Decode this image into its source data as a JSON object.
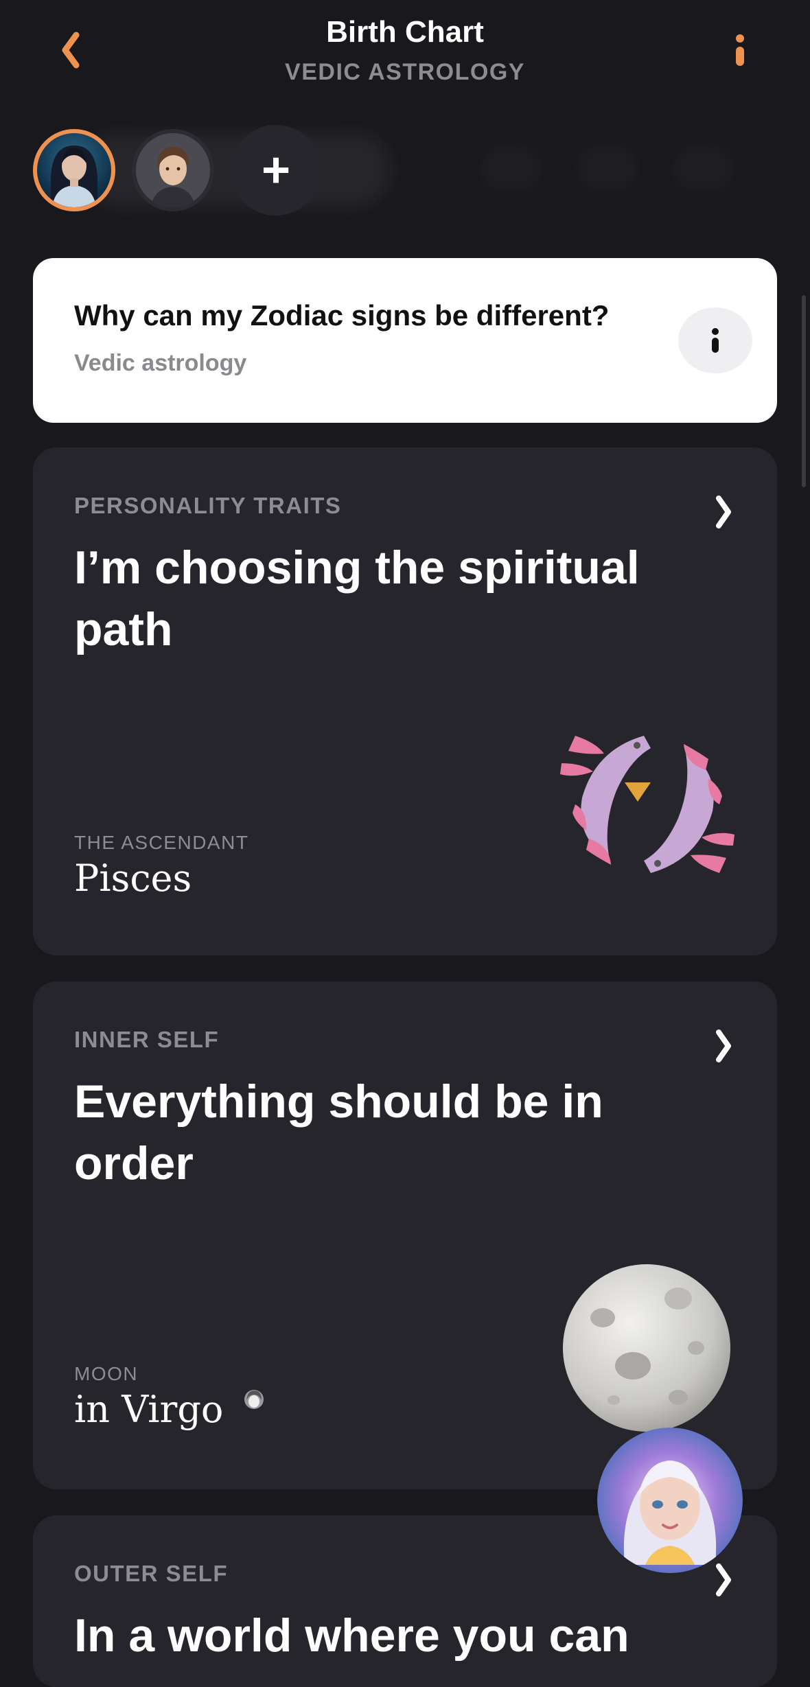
{
  "header": {
    "title": "Birth Chart",
    "subtitle": "VEDIC ASTROLOGY"
  },
  "colors": {
    "accent": "#f0924f",
    "background": "#18181d",
    "card": "#25252b",
    "muted_text": "#8d8c92"
  },
  "profiles": {
    "add_label": "+"
  },
  "info_card": {
    "title": "Why can my Zodiac signs be different?",
    "subtitle": "Vedic astrology"
  },
  "cards": [
    {
      "label": "PERSONALITY TRAITS",
      "title": "I’m choosing the spiritual path",
      "caption": "THE ASCENDANT",
      "value": "Pisces",
      "icon": "pisces-icon"
    },
    {
      "label": "INNER SELF",
      "title": "Everything should be in order",
      "caption": "MOON",
      "value": "in Virgo",
      "icon": "moon-icon"
    },
    {
      "label": "OUTER SELF",
      "title": "In a world where you can"
    }
  ]
}
